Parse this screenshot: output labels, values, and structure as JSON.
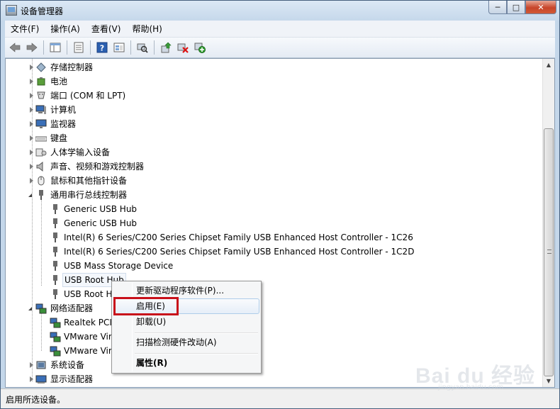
{
  "window": {
    "title": "设备管理器"
  },
  "menu": [
    "文件(F)",
    "操作(A)",
    "查看(V)",
    "帮助(H)"
  ],
  "toolbar": {
    "icons": [
      "back-arrow-icon",
      "forward-arrow-icon",
      "show-hide-tree-icon",
      "properties-icon",
      "help-icon",
      "view-icon",
      "scan-hardware-icon",
      "update-driver-icon",
      "uninstall-icon",
      "enable-device-icon"
    ]
  },
  "tree": {
    "nodes": [
      {
        "label": "存储控制器",
        "state": "collapsed",
        "level": 0,
        "icon": "storage-controller-icon"
      },
      {
        "label": "电池",
        "state": "collapsed",
        "level": 0,
        "icon": "battery-icon"
      },
      {
        "label": "端口 (COM 和 LPT)",
        "state": "collapsed",
        "level": 0,
        "icon": "port-icon"
      },
      {
        "label": "计算机",
        "state": "collapsed",
        "level": 0,
        "icon": "computer-icon"
      },
      {
        "label": "监视器",
        "state": "collapsed",
        "level": 0,
        "icon": "monitor-icon"
      },
      {
        "label": "键盘",
        "state": "collapsed",
        "level": 0,
        "icon": "keyboard-icon"
      },
      {
        "label": "人体学输入设备",
        "state": "collapsed",
        "level": 0,
        "icon": "hid-icon"
      },
      {
        "label": "声音、视频和游戏控制器",
        "state": "collapsed",
        "level": 0,
        "icon": "speaker-icon"
      },
      {
        "label": "鼠标和其他指针设备",
        "state": "collapsed",
        "level": 0,
        "icon": "mouse-icon"
      },
      {
        "label": "通用串行总线控制器",
        "state": "expanded",
        "level": 0,
        "icon": "usb-controller-icon"
      },
      {
        "label": "Generic USB Hub",
        "level": 1,
        "icon": "usb-icon"
      },
      {
        "label": "Generic USB Hub",
        "level": 1,
        "icon": "usb-icon"
      },
      {
        "label": "Intel(R) 6 Series/C200 Series Chipset Family USB Enhanced Host Controller - 1C26",
        "level": 1,
        "icon": "usb-icon"
      },
      {
        "label": "Intel(R) 6 Series/C200 Series Chipset Family USB Enhanced Host Controller - 1C2D",
        "level": 1,
        "icon": "usb-icon"
      },
      {
        "label": "USB Mass Storage Device",
        "level": 1,
        "icon": "usb-icon"
      },
      {
        "label": "USB Root Hub",
        "level": 1,
        "icon": "usb-icon",
        "highlight": true
      },
      {
        "label": "USB Root H",
        "level": 1,
        "icon": "usb-icon"
      },
      {
        "label": "网络适配器",
        "state": "expanded",
        "level": 0,
        "icon": "network-adapter-icon"
      },
      {
        "label": "Realtek PCI",
        "level": 1,
        "icon": "network-card-icon"
      },
      {
        "label": "VMware Vir",
        "level": 1,
        "icon": "network-card-icon"
      },
      {
        "label": "VMware Vir",
        "level": 1,
        "icon": "network-card-icon"
      },
      {
        "label": "系统设备",
        "state": "collapsed",
        "level": 0,
        "icon": "system-device-icon"
      },
      {
        "label": "显示适配器",
        "state": "collapsed",
        "level": 0,
        "icon": "display-adapter-icon"
      }
    ]
  },
  "context_menu": {
    "update_driver": "更新驱动程序软件(P)...",
    "enable": "启用(E)",
    "uninstall": "卸载(U)",
    "scan": "扫描检测硬件改动(A)",
    "properties": "属性(R)"
  },
  "status": {
    "text": "启用所选设备。"
  },
  "watermark": {
    "text": "Bai du 经验",
    "sub": "jingyan.baidu.com"
  },
  "colors": {
    "highlight_box": "#c8101a",
    "selection": "#aecde9"
  }
}
